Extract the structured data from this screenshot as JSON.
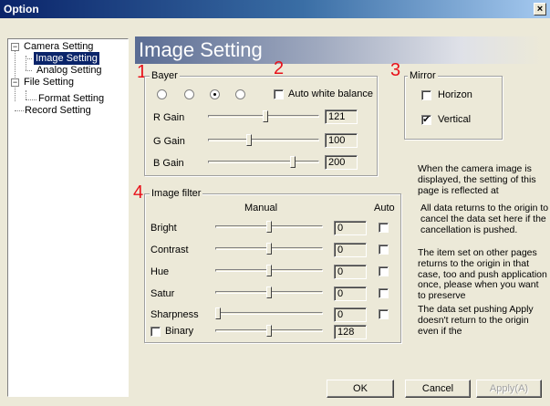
{
  "window": {
    "title": "Option",
    "close_glyph": "×"
  },
  "tree": {
    "collapse_glyph": "−",
    "items": [
      {
        "label": "Camera Setting"
      },
      {
        "label": "Image Setting"
      },
      {
        "label": "Analog Setting"
      },
      {
        "label": "File Setting"
      },
      {
        "label": "Format Setting"
      },
      {
        "label": "Record Setting"
      }
    ]
  },
  "page": {
    "title": "Image Setting"
  },
  "annotations": {
    "n1": "1",
    "n2": "2",
    "n3": "3",
    "n4": "4",
    "color": "#e8111a"
  },
  "bayer": {
    "label": "Bayer",
    "radio_selected": 3,
    "auto_white_balance": {
      "label": "Auto white balance",
      "checked": false
    },
    "gains": [
      {
        "label": "R Gain",
        "value": "121",
        "level": 0.52
      },
      {
        "label": "G Gain",
        "value": "100",
        "level": 0.36
      },
      {
        "label": "B Gain",
        "value": "200",
        "level": 0.78
      }
    ]
  },
  "mirror": {
    "label": "Mirror",
    "horizon": {
      "label": "Horizon",
      "checked": false
    },
    "vertical": {
      "label": "Vertical",
      "checked": true,
      "check_glyph": "✔"
    }
  },
  "image_filter": {
    "label": "Image filter",
    "col_manual": "Manual",
    "col_auto": "Auto",
    "rows": [
      {
        "label": "Bright",
        "value": "0",
        "level": 0.5
      },
      {
        "label": "Contrast",
        "value": "0",
        "level": 0.5
      },
      {
        "label": "Hue",
        "value": "0",
        "level": 0.5
      },
      {
        "label": "Satur",
        "value": "0",
        "level": 0.5
      },
      {
        "label": "Sharpness",
        "value": "0",
        "level": 0.0
      }
    ],
    "binary": {
      "label": "Binary",
      "value": "128",
      "level": 0.5,
      "checked": false
    }
  },
  "info": {
    "p1": "When the camera image is displayed, the setting of this page is reflected at",
    "p2": "All data returns to the origin to cancel the data set here if the cancellation is pushed.",
    "p3": "The item set on other pages returns to the origin in that case, too and push application once, please when you want to preserve",
    "p4": "The data set pushing Apply doesn't return to the origin even if the"
  },
  "buttons": {
    "ok": "OK",
    "cancel": "Cancel",
    "apply": "Apply(A)"
  }
}
